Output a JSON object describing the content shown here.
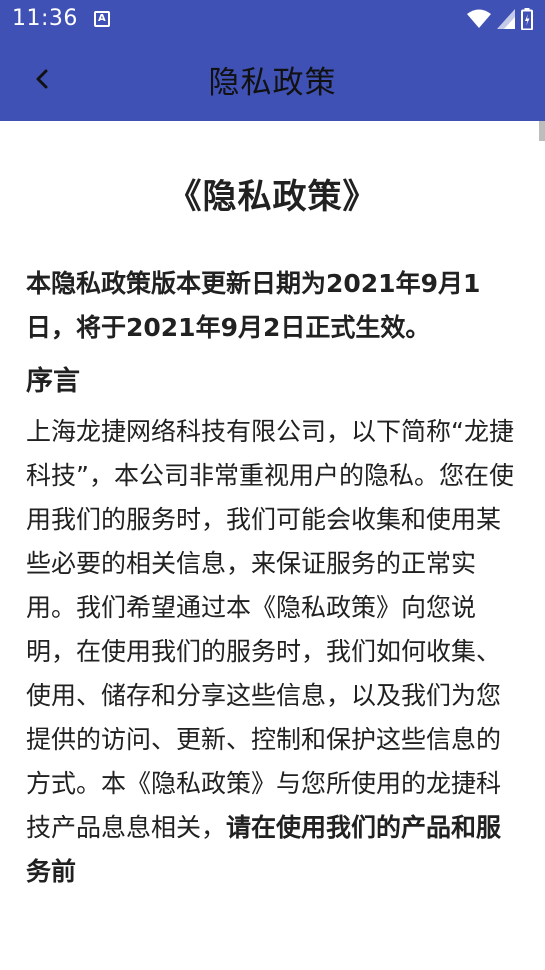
{
  "status_bar": {
    "time": "11:36",
    "indicator_icon": "a-notification-icon",
    "icons": [
      "wifi-icon",
      "cell-signal-icon",
      "battery-icon"
    ]
  },
  "app_bar": {
    "title": "隐私政策",
    "back_icon": "chevron-left-icon"
  },
  "document": {
    "title": "《隐私政策》",
    "update_note": "本隐私政策版本更新日期为2021年9月1日，将于2021年9月2日正式生效。",
    "section_heading": "序言",
    "paragraph": "上海龙捷网络科技有限公司，以下简称“龙捷科技”，本公司非常重视用户的隐私。您在使用我们的服务时，我们可能会收集和使用某些必要的相关信息，来保证服务的正常实用。我们希望通过本《隐私政策》向您说明，在使用我们的服务时，我们如何收集、使用、储存和分享这些信息，以及我们为您提供的访问、更新、控制和保护这些信息的方式。本《隐私政策》与您所使用的龙捷科技产品息息相关，",
    "paragraph_bold_tail": "请在使用我们的产品和服务前"
  },
  "colors": {
    "primary": "#3f51b5",
    "text": "#212121",
    "background": "#ffffff"
  }
}
